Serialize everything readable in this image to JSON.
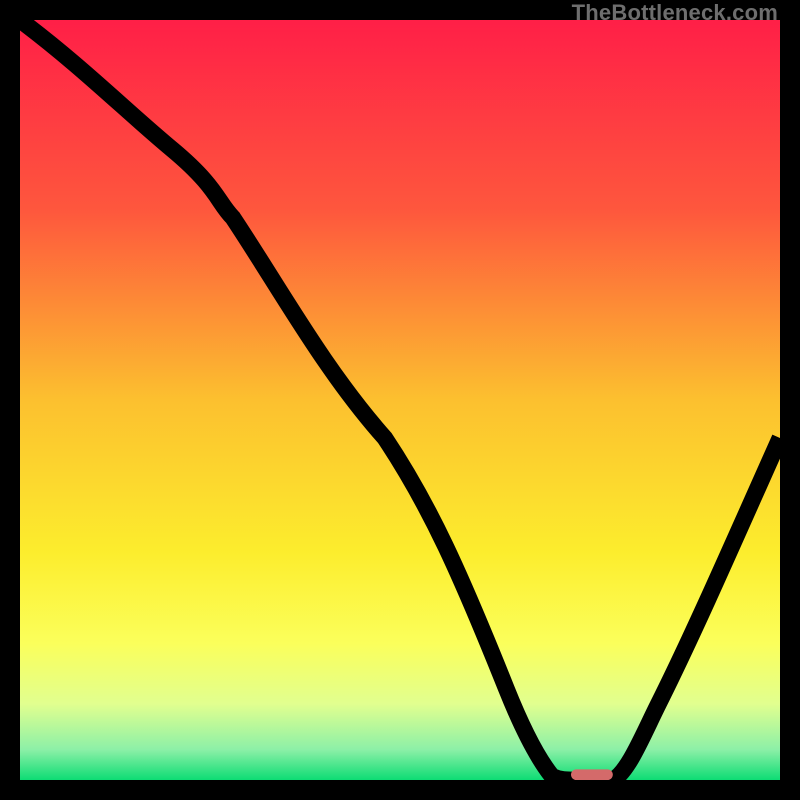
{
  "watermark": "TheBottleneck.com",
  "chart_data": {
    "type": "line",
    "title": "",
    "xlabel": "",
    "ylabel": "",
    "xlim": [
      0,
      100
    ],
    "ylim": [
      0,
      100
    ],
    "grid": false,
    "legend": false,
    "background_gradient": {
      "stops": [
        {
          "pos": 0.0,
          "color": "#ff1f47"
        },
        {
          "pos": 0.25,
          "color": "#fe573d"
        },
        {
          "pos": 0.5,
          "color": "#fcc02f"
        },
        {
          "pos": 0.7,
          "color": "#fced2d"
        },
        {
          "pos": 0.82,
          "color": "#fbff5b"
        },
        {
          "pos": 0.9,
          "color": "#e1ff8f"
        },
        {
          "pos": 0.96,
          "color": "#8cf0a7"
        },
        {
          "pos": 1.0,
          "color": "#0ddc74"
        }
      ]
    },
    "series": [
      {
        "name": "bottleneck-curve",
        "x": [
          0,
          10,
          20,
          28,
          38,
          48,
          58,
          64,
          68,
          72,
          78,
          84,
          92,
          100
        ],
        "y": [
          100,
          92,
          83,
          74,
          60,
          45,
          27,
          12,
          3,
          0,
          0,
          10,
          27,
          45
        ]
      }
    ],
    "marker": {
      "name": "optimal-point",
      "x": 75,
      "y": 0,
      "color": "#d46a6a"
    }
  }
}
